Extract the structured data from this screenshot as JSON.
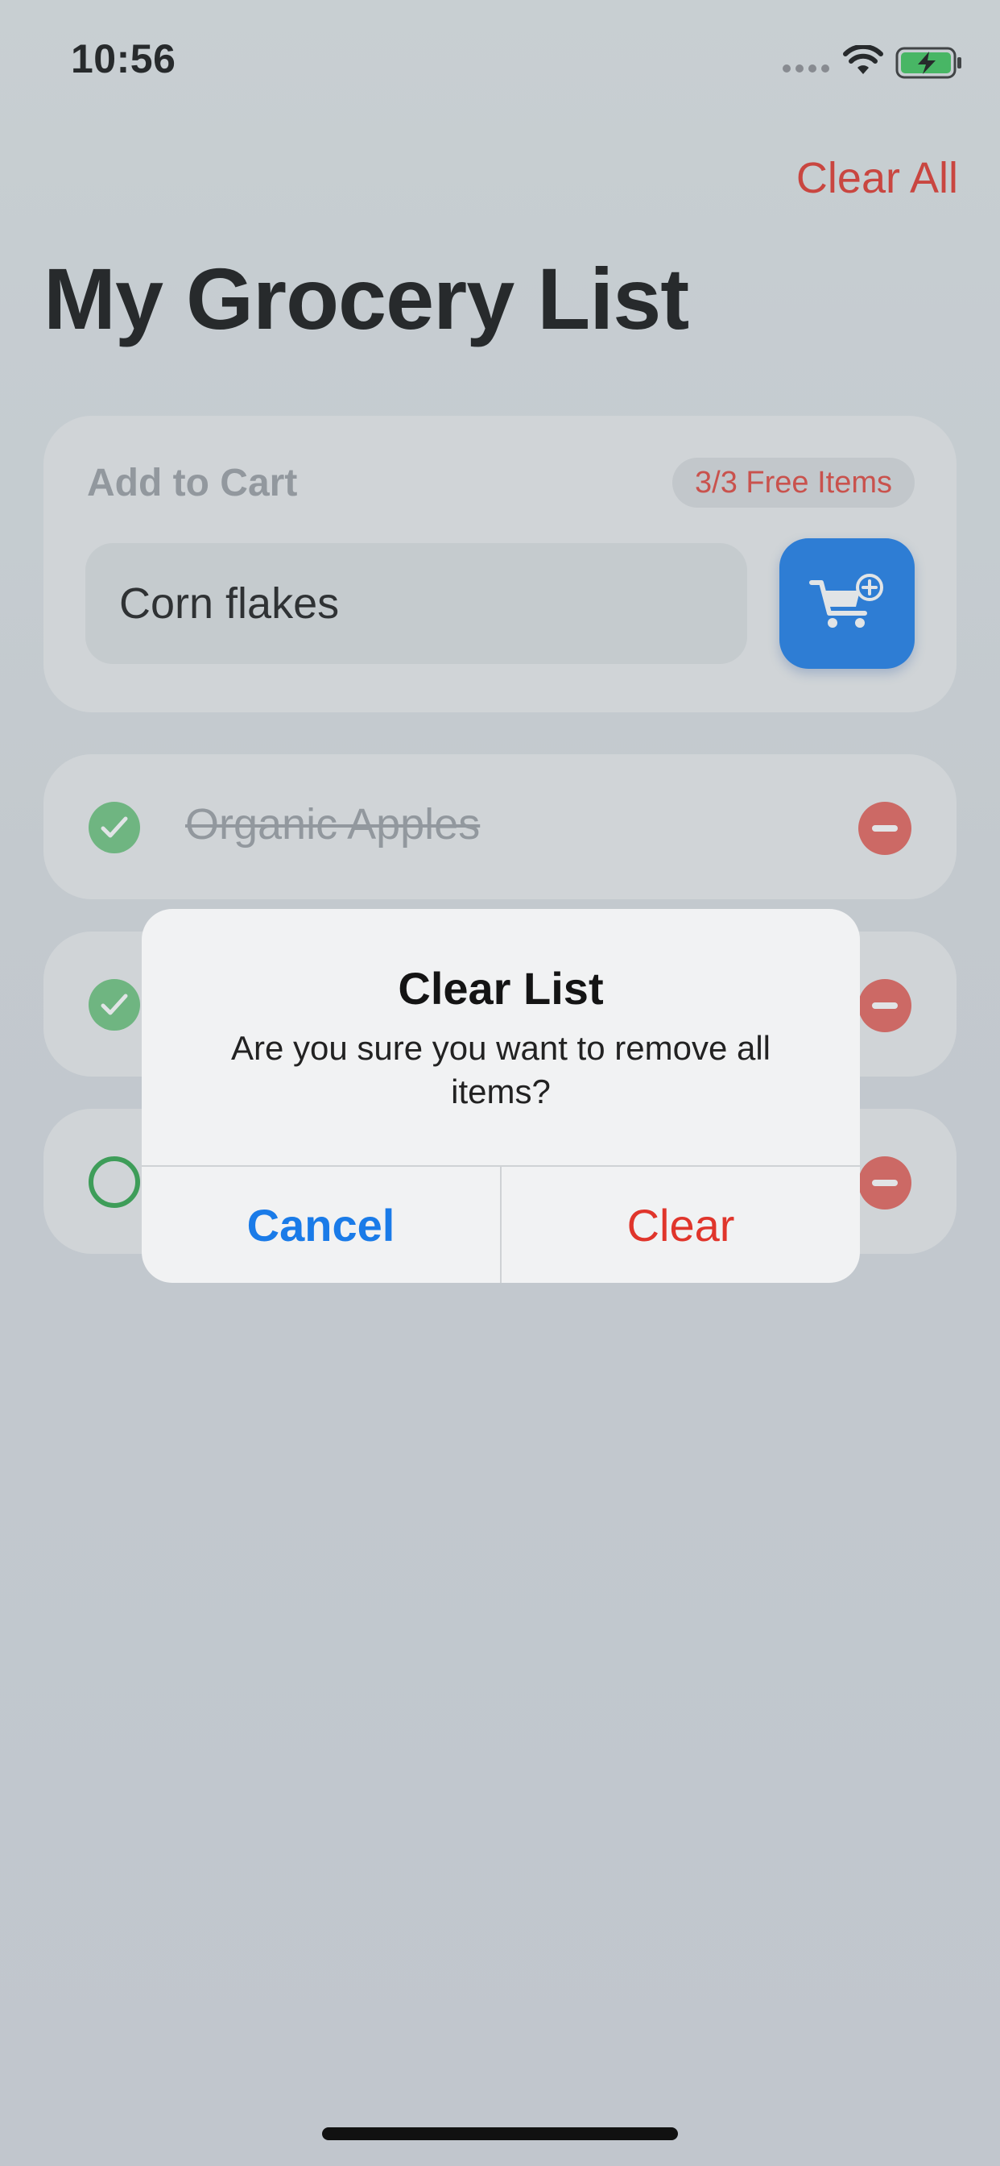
{
  "status_bar": {
    "time": "10:56"
  },
  "header": {
    "clear_all_label": "Clear All",
    "title": "My Grocery List"
  },
  "add_card": {
    "label": "Add to Cart",
    "badge": "3/3 Free Items",
    "input_value": "Corn flakes"
  },
  "items": [
    {
      "name": "Organic Apples",
      "done": true
    },
    {
      "name": "",
      "done": true
    },
    {
      "name": "",
      "done": false
    }
  ],
  "alert": {
    "title": "Clear List",
    "message": "Are you sure you want to remove all items?",
    "cancel_label": "Cancel",
    "confirm_label": "Clear"
  },
  "colors": {
    "accent_blue": "#1a7be8",
    "destructive_red": "#e0352b",
    "check_green": "#2fa44b"
  }
}
